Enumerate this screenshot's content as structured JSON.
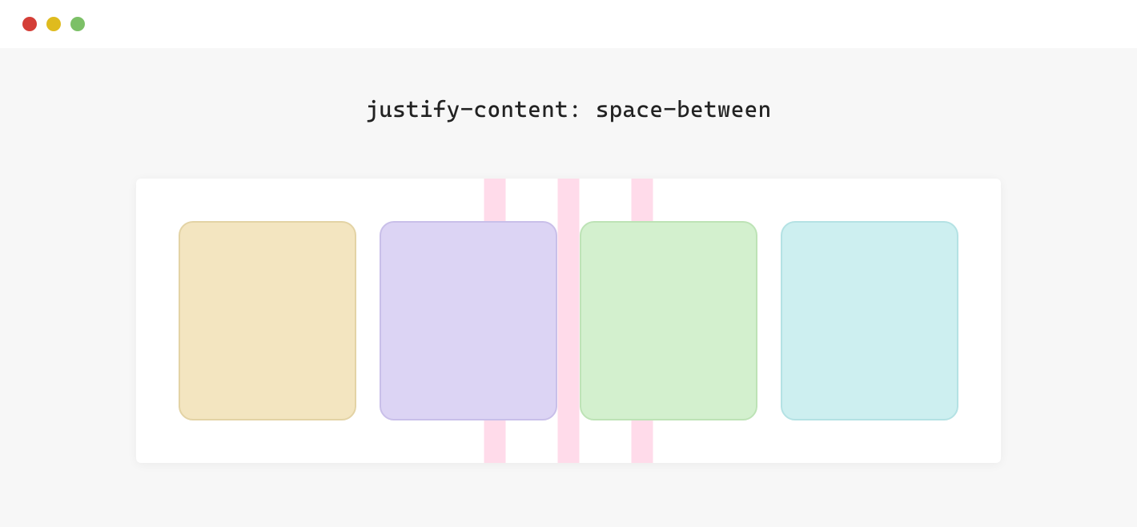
{
  "heading": "justify-content: space-between",
  "boxes": [
    {
      "fill": "#f3e5c0",
      "stroke": "#e3d3a5"
    },
    {
      "fill": "#dcd4f4",
      "stroke": "#c9bfe9"
    },
    {
      "fill": "#d3f0ce",
      "stroke": "#bde3b6"
    },
    {
      "fill": "#cdeff0",
      "stroke": "#b4e2e4"
    }
  ],
  "gap_color": "#ffdbea",
  "traffic_lights": [
    "#d43e37",
    "#dfbb1e",
    "#7cc067"
  ]
}
